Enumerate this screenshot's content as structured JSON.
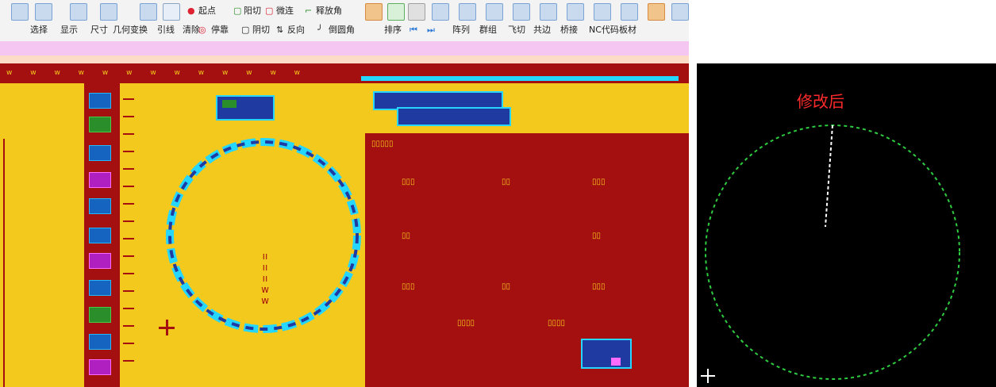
{
  "ribbon": {
    "row1": {
      "start_point": "起点",
      "yang_cut": "阳切",
      "micro_join": "微连",
      "release_corner": "释放角"
    },
    "row2": {
      "select": "选择",
      "display": "显示",
      "size": "尺寸",
      "geometry_transform": "几何变换",
      "lead_line": "引线",
      "clear": "清除",
      "stop_point": "停靠",
      "yin_cut": "阴切",
      "reverse": "反向",
      "chamfer": "倒圆角",
      "sort": "排序",
      "array": "阵列",
      "group": "群组",
      "fly_cut": "飞切",
      "common_edge": "共边",
      "bridge": "桥接",
      "nc_code": "NC代码",
      "sheet": "板材"
    }
  },
  "right_panel": {
    "caption": "修改后",
    "circle_color": "#2ecc40",
    "leadin_color": "#ffffff"
  },
  "colors": {
    "yellow_bg": "#f4c91d",
    "dark_red": "#a40f10",
    "cyan": "#25d7ff",
    "blue": "#1f3aa0"
  }
}
